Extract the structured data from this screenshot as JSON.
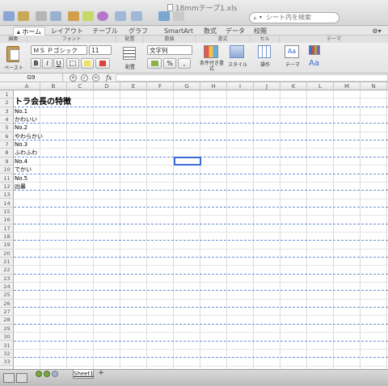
{
  "window": {
    "title": "18mmテープ1.xls"
  },
  "search": {
    "placeholder": "シート内を検索"
  },
  "tabs": [
    "ホーム",
    "レイアウト",
    "テーブル",
    "グラフ",
    "SmartArt",
    "数式",
    "データ",
    "校閲"
  ],
  "ribbon": {
    "groups": [
      "編集",
      "フォント",
      "配置",
      "数値",
      "書式",
      "セル",
      "テーマ"
    ],
    "paste_label": "ペースト",
    "font_name": "ＭＳ Ｐゴシック",
    "font_size": "11",
    "bold": "B",
    "italic": "I",
    "underline": "U",
    "align_label": "配置",
    "number_format": "文字列",
    "percent": "%",
    "comma": ",",
    "cond_format_label": "条件付き書式",
    "style_label": "スタイル",
    "ops_label": "操作",
    "theme_label": "テーマ",
    "font_aa": "Aa"
  },
  "formula": {
    "cell_ref": "G9",
    "fx": "fx",
    "value": ""
  },
  "columns": [
    "A",
    "B",
    "C",
    "D",
    "E",
    "F",
    "G",
    "H",
    "I",
    "J",
    "K",
    "L",
    "M",
    "N"
  ],
  "rows": [
    "1",
    "2",
    "3",
    "4",
    "5",
    "6",
    "7",
    "8",
    "9",
    "10",
    "11",
    "12",
    "13",
    "14",
    "15",
    "16",
    "17",
    "18",
    "19",
    "20",
    "21",
    "22",
    "23",
    "24",
    "25",
    "26",
    "27",
    "28",
    "29",
    "30",
    "31",
    "32",
    "33"
  ],
  "cells": [
    {
      "row": 2,
      "text": "トラ会長の特徴"
    },
    {
      "row": 3,
      "text": "No.1"
    },
    {
      "row": 4,
      "text": "かわいい"
    },
    {
      "row": 5,
      "text": "No.2"
    },
    {
      "row": 6,
      "text": "やわらかい"
    },
    {
      "row": 7,
      "text": "No.3"
    },
    {
      "row": 8,
      "text": "ふわふわ"
    },
    {
      "row": 9,
      "text": "No.4"
    },
    {
      "row": 10,
      "text": "でかい"
    },
    {
      "row": 11,
      "text": "No.5"
    },
    {
      "row": 12,
      "text": "凶暴"
    }
  ],
  "sheets": {
    "active": "Sheet1",
    "add": "+"
  },
  "colors": {
    "accent": "#3b6cd6",
    "page_break": "#6a8fd8"
  }
}
